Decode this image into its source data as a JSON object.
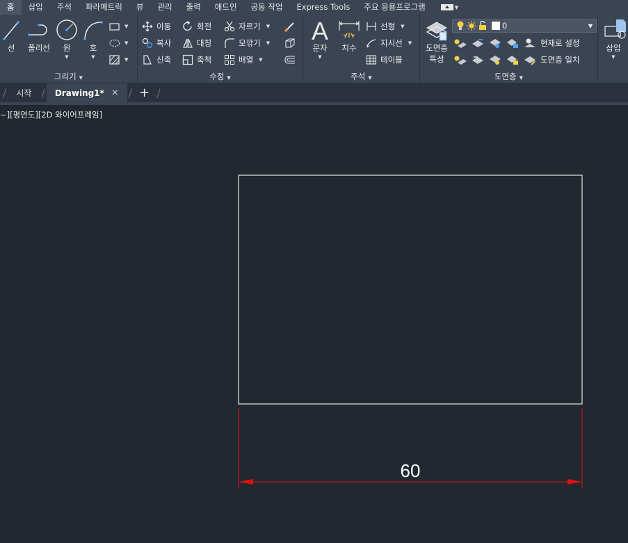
{
  "menu": {
    "tabs": [
      "홈",
      "삽입",
      "주석",
      "파라메트릭",
      "뷰",
      "관리",
      "출력",
      "애드인",
      "공동 작업",
      "Express Tools",
      "주요 응용프로그램"
    ],
    "active": "홈"
  },
  "ribbon": {
    "draw": {
      "title": "그리기",
      "line": "선",
      "polyline": "폴리선",
      "circle": "원",
      "arc": "호"
    },
    "modify": {
      "title": "수정",
      "move": "이동",
      "rotate": "회전",
      "trim": "자르기",
      "copy": "복사",
      "mirror": "대칭",
      "fillet": "모깎기",
      "stretch": "신축",
      "scale": "축척",
      "array": "배열"
    },
    "annotation": {
      "title": "주석",
      "text": "문자",
      "dimension": "치수",
      "linear": "선형",
      "leader": "지시선",
      "table": "테이블"
    },
    "layers": {
      "title": "도면층",
      "properties_line1": "도면층",
      "properties_line2": "특성",
      "current_layer": "0",
      "make_current": "현재로 설정",
      "match_layer": "도면층 일치"
    },
    "insert": {
      "label": "삽입"
    }
  },
  "doc_tabs": {
    "start": "시작",
    "drawing": "Drawing1*",
    "close": "×",
    "add": "+"
  },
  "viewport": {
    "label": "−][평면도][2D 와이어프레임]"
  },
  "drawing": {
    "dimension_value": "60",
    "rect_color": "#d9d9d9",
    "dim_color": "#e01010"
  }
}
